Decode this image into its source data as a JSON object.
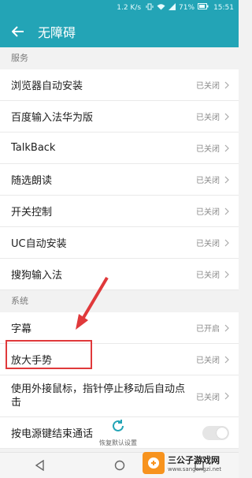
{
  "status_bar": {
    "speed": "1.2 K/s",
    "battery": "71%",
    "time": "15:51"
  },
  "app_bar": {
    "title": "无障碍"
  },
  "sections": [
    {
      "header": "服务",
      "items": [
        {
          "label": "浏览器自动安装",
          "status": "已关闭"
        },
        {
          "label": "百度输入法华为版",
          "status": "已关闭"
        },
        {
          "label": "TalkBack",
          "status": "已关闭"
        },
        {
          "label": "随选朗读",
          "status": "已关闭"
        },
        {
          "label": "开关控制",
          "status": "已关闭"
        },
        {
          "label": "UC自动安装",
          "status": "已关闭"
        },
        {
          "label": "搜狗输入法",
          "status": "已关闭"
        }
      ]
    },
    {
      "header": "系统",
      "items": [
        {
          "label": "字幕",
          "status": "已开启"
        },
        {
          "label": "放大手势",
          "status": "已关闭"
        },
        {
          "label": "使用外接鼠标，指针停止移动后自动点击",
          "status": "已关闭"
        },
        {
          "label": "按电源键结束通话"
        }
      ]
    }
  ],
  "restore_default": "恢复默认设置",
  "watermark": {
    "title": "三公子游戏网",
    "url": "www.sangongzi.net"
  },
  "colors": {
    "accent": "#23a4b6",
    "highlight": "#e0393b"
  }
}
